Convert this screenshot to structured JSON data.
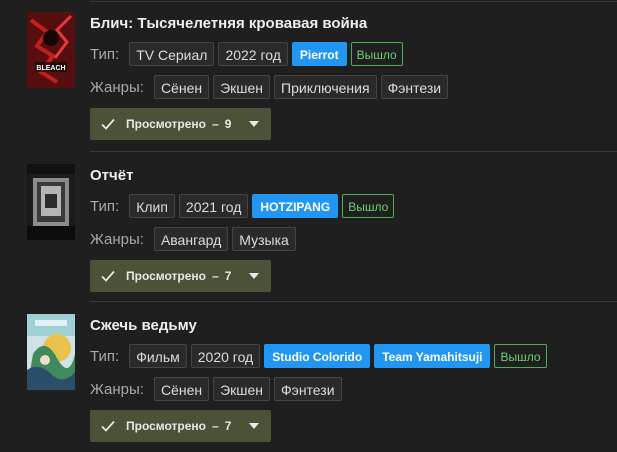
{
  "labels": {
    "type": "Тип:",
    "genres": "Жанры:",
    "watched": "Просмотрено",
    "sep": "–"
  },
  "entries": [
    {
      "title": "Блич: Тысячелетняя кровавая война",
      "type": "TV Сериал",
      "year": "2022 год",
      "studios": [
        "Pierrot"
      ],
      "status": "Вышло",
      "genres": [
        "Сёнен",
        "Экшен",
        "Приключения",
        "Фэнтези"
      ],
      "watched_count": "9",
      "poster_text": "BLEACH"
    },
    {
      "title": "Отчёт",
      "type": "Клип",
      "year": "2021 год",
      "studios": [
        "HOTZIPANG"
      ],
      "status": "Вышло",
      "genres": [
        "Авангард",
        "Музыка"
      ],
      "watched_count": "7"
    },
    {
      "title": "Сжечь ведьму",
      "type": "Фильм",
      "year": "2020 год",
      "studios": [
        "Studio Colorido",
        "Team Yamahitsuji"
      ],
      "status": "Вышло",
      "genres": [
        "Сёнен",
        "Экшен",
        "Фэнтези"
      ],
      "watched_count": "7"
    }
  ],
  "colors": {
    "background": "#1f1f1f",
    "studio": "#2196f3",
    "status": "#4caf50",
    "watch_button": "#4a5238"
  }
}
